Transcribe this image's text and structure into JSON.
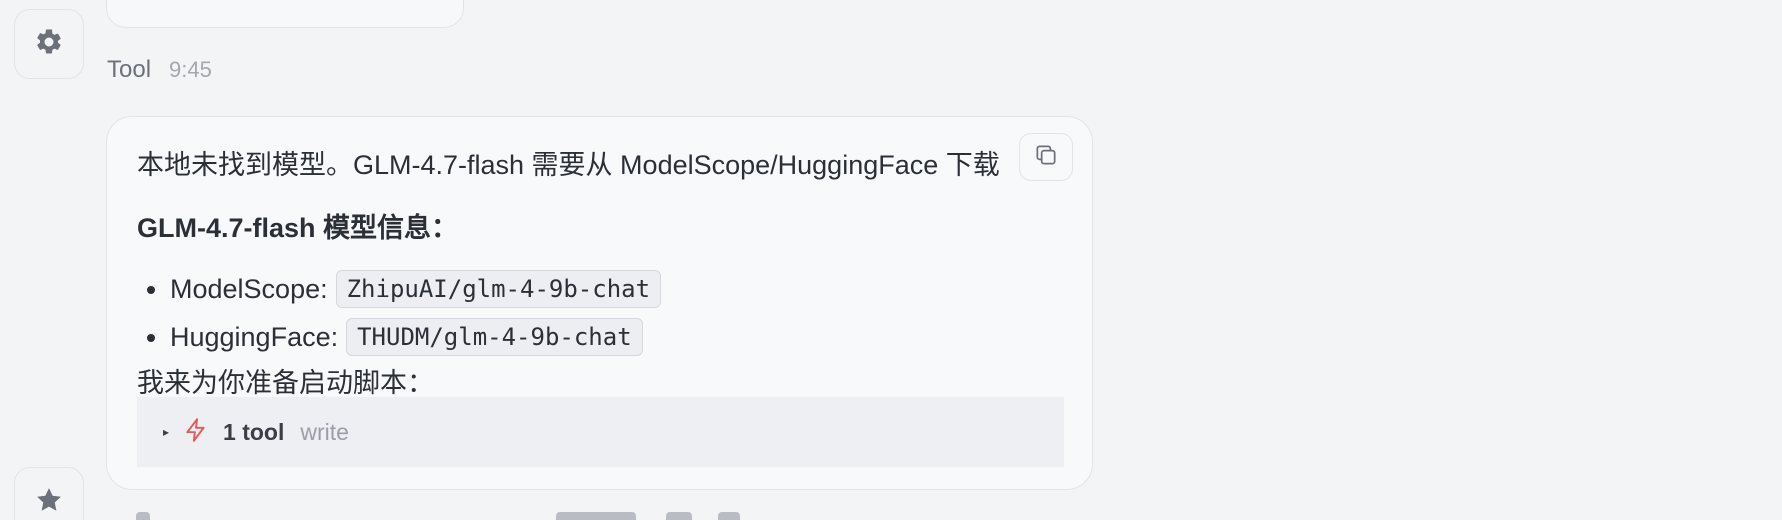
{
  "message": {
    "sender": "Tool",
    "time": "9:45",
    "intro": "本地未找到模型。GLM-4.7-flash 需要从 ModelScope/HuggingFace 下载",
    "heading": "GLM-4.7-flash 模型信息：",
    "links": [
      {
        "label": "ModelScope:",
        "code": "ZhipuAI/glm-4-9b-chat"
      },
      {
        "label": "HuggingFace:",
        "code": "THUDM/glm-4-9b-chat"
      }
    ],
    "after": "我来为你准备启动脚本：",
    "tool_summary": {
      "count": "1 tool",
      "name": "write"
    }
  },
  "icons": {
    "settings": "gear-icon",
    "star": "star-icon",
    "copy": "copy-icon",
    "bolt": "lightning-icon"
  },
  "colors": {
    "background": "#f3f4f6",
    "card": "#f8f9fb",
    "border": "#e2e4e8",
    "bolt": "#e05a5a"
  }
}
